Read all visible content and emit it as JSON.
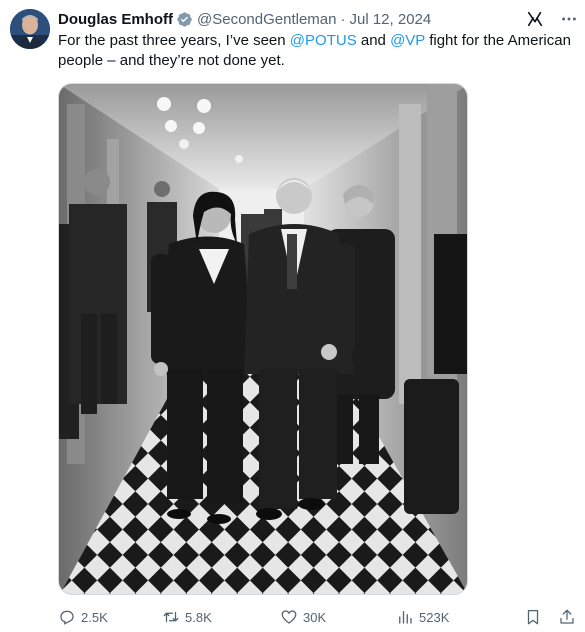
{
  "author": {
    "name": "Douglas Emhoff",
    "handle": "@SecondGentleman",
    "separator": "·",
    "date": "Jul 12, 2024"
  },
  "tweet": {
    "text_part1": "For the past three years, I’ve seen ",
    "mention1": "@POTUS",
    "text_part2": " and ",
    "mention2": "@VP",
    "text_part3": " fight for the American people – and they’re not done yet."
  },
  "icons": {
    "verified": "verified-badge-icon",
    "grok": "grok-icon",
    "more": "more-options-icon",
    "reply": "reply-icon",
    "repost": "repost-icon",
    "like": "heart-icon",
    "views": "views-icon",
    "bookmark": "bookmark-icon",
    "share": "share-icon"
  },
  "actions": {
    "replies": "2.5K",
    "reposts": "5.8K",
    "likes": "30K",
    "views": "523K"
  },
  "colors": {
    "accent": "#1d9bf0",
    "secondary_text": "#536471",
    "primary_text": "#0f1419",
    "verified_badge": "#829aab"
  }
}
